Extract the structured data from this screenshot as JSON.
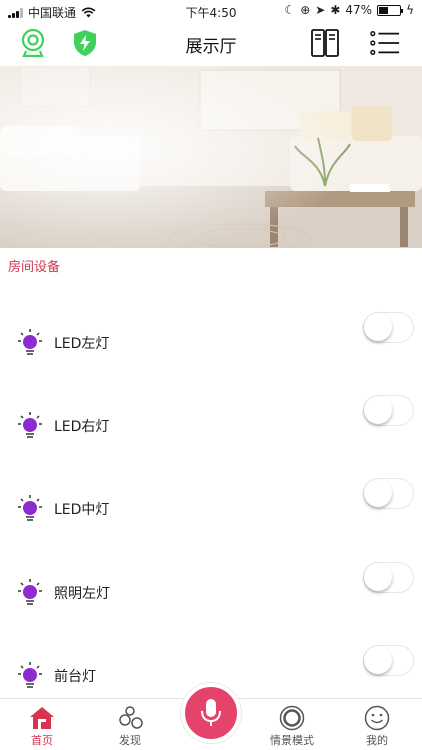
{
  "status_bar": {
    "carrier": "中国联通",
    "time": "下午4:50",
    "battery_percent": "47%",
    "battery_level": 0.47
  },
  "header": {
    "title": "展示厅",
    "left_icons": [
      "camera-icon",
      "shield-bolt-icon"
    ],
    "right_icons": [
      "panel-switch-icon",
      "menu-list-icon"
    ],
    "accent_green": "#3fd15b"
  },
  "section": {
    "label": "房间设备",
    "color": "#d8344f"
  },
  "devices": [
    {
      "name": "LED左灯",
      "icon": "bulb-icon",
      "on": false
    },
    {
      "name": "LED右灯",
      "icon": "bulb-icon",
      "on": false
    },
    {
      "name": "LED中灯",
      "icon": "bulb-icon",
      "on": false
    },
    {
      "name": "照明左灯",
      "icon": "bulb-icon",
      "on": false
    },
    {
      "name": "前台灯",
      "icon": "bulb-icon",
      "on": false
    }
  ],
  "tabbar": {
    "home": "首页",
    "discover": "发现",
    "scene": "情景模式",
    "mine": "我的",
    "mic_color": "#e4436a"
  }
}
